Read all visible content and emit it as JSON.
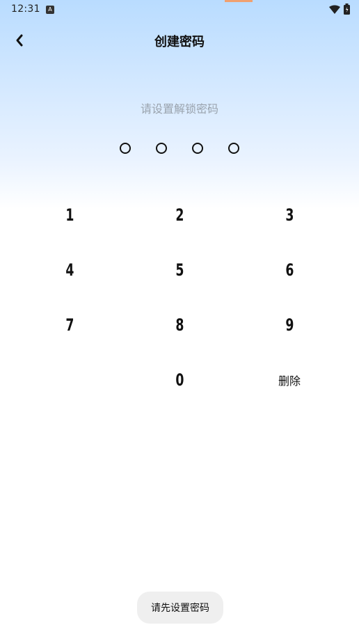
{
  "status_bar": {
    "time": "12:31",
    "app_icon": "A",
    "icons": [
      "wifi-icon",
      "battery-icon"
    ]
  },
  "header": {
    "back_icon": "chevron-left-icon",
    "title": "创建密码"
  },
  "prompt": "请设置解锁密码",
  "pin": {
    "length": 4,
    "entered": 0
  },
  "keypad": {
    "keys": [
      "1",
      "2",
      "3",
      "4",
      "5",
      "6",
      "7",
      "8",
      "9",
      "0"
    ],
    "delete_label": "删除"
  },
  "toast": "请先设置密码",
  "colors": {
    "gradient_top": "#b9dcff",
    "prompt_text": "#9aa3ad",
    "toast_bg": "#efefef"
  }
}
